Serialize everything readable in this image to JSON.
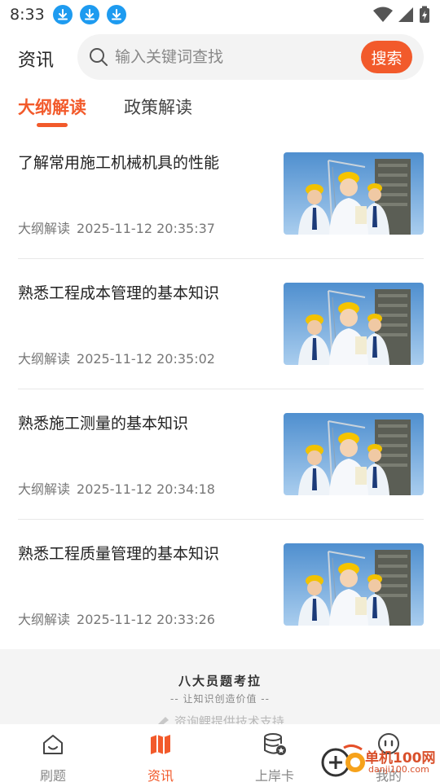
{
  "status_bar": {
    "time": "8:33"
  },
  "header": {
    "title": "资讯",
    "search_placeholder": "输入关键词查找",
    "search_button": "搜索"
  },
  "tabs": [
    {
      "label": "大纲解读",
      "active": true
    },
    {
      "label": "政策解读",
      "active": false
    }
  ],
  "articles": [
    {
      "title": "了解常用施工机械机具的性能",
      "category": "大纲解读",
      "time": "2025-11-12 20:35:37"
    },
    {
      "title": "熟悉工程成本管理的基本知识",
      "category": "大纲解读",
      "time": "2025-11-12 20:35:02"
    },
    {
      "title": "熟悉施工测量的基本知识",
      "category": "大纲解读",
      "time": "2025-11-12 20:34:18"
    },
    {
      "title": "熟悉工程质量管理的基本知识",
      "category": "大纲解读",
      "time": "2025-11-12 20:33:26"
    }
  ],
  "footer": {
    "brand": "八大员题考拉",
    "slogan": "-- 让知识创造价值 --",
    "support": "资询鲤提供技术支持"
  },
  "bottom_nav": [
    {
      "label": "刷题",
      "icon": "home-icon",
      "active": false
    },
    {
      "label": "资讯",
      "icon": "map-icon",
      "active": true
    },
    {
      "label": "上岸卡",
      "icon": "database-star-icon",
      "active": false
    },
    {
      "label": "我的",
      "icon": "chat-icon",
      "active": false
    }
  ],
  "watermark": {
    "text": "单机100网",
    "sub": "danji100.com"
  },
  "colors": {
    "accent": "#f25a2b",
    "download_badge": "#1e9bf0"
  }
}
